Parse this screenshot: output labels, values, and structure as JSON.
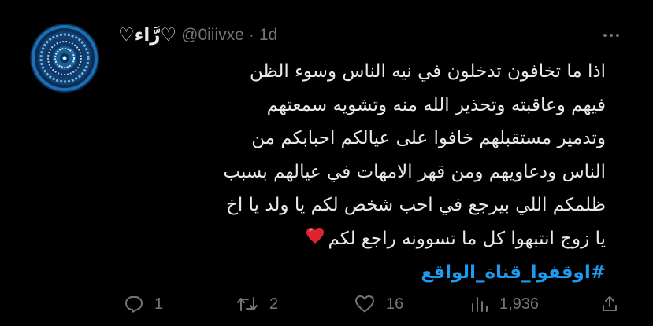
{
  "tweet": {
    "display_name": "♡رَّاء♡",
    "handle": "@0iiivxe",
    "separator": "·",
    "time": "1d",
    "body_lines": [
      "اذا ما تخافون تدخلون في نيه الناس وسوء الظن",
      "فيهم وعاقبته وتحذير الله منه وتشويه سمعتهم",
      "وتدمير مستقبلهم خافوا على عيالكم احبابكم من",
      "الناس ودعاويهم ومن قهر الامهات في عيالهم بسبب",
      "ظلمكم اللي بيرجع في احب شخص لكم يا ولد يا اخ",
      "يا زوج انتبهوا كل ما تسوونه راجع لكم"
    ],
    "hashtag": "#اوقفوا_قناة_الواقع"
  },
  "actions": {
    "reply_count": "1",
    "retweet_count": "2",
    "like_count": "16",
    "views_count": "1,936"
  },
  "icons": {
    "reply": "reply-icon",
    "retweet": "retweet-icon",
    "like": "heart-icon",
    "views": "views-icon",
    "share": "share-icon",
    "more": "more-icon",
    "emoji": "red-heart-emoji"
  },
  "colors": {
    "background": "#000000",
    "text": "#e7e9ea",
    "secondary": "#71767b",
    "hashtag": "#1d9bf0",
    "heart_emoji": "#e0242f"
  }
}
